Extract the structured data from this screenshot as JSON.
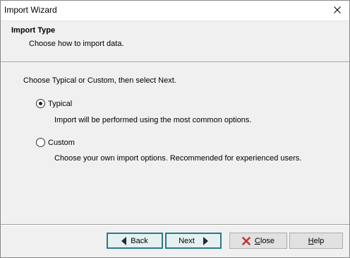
{
  "window": {
    "title": "Import Wizard"
  },
  "header": {
    "title": "Import Type",
    "subtitle": "Choose how to import data."
  },
  "body": {
    "instruction": "Choose Typical or Custom, then select Next.",
    "options": [
      {
        "label": "Typical",
        "description": "Import will be performed using the most common options.",
        "selected": true
      },
      {
        "label": "Custom",
        "description": "Choose your own import options. Recommended for experienced users.",
        "selected": false
      }
    ]
  },
  "footer": {
    "back_label": "Back",
    "next_label": "Next",
    "close_label_underlined": "C",
    "close_label_rest": "lose",
    "help_label_underlined": "H",
    "help_label_rest": "elp"
  },
  "colors": {
    "accent_border": "#2b7a8a",
    "close_icon": "#c0392b",
    "nav_arrow": "#1f2b3a",
    "panel_bg": "#f0f0f0"
  },
  "icons": {
    "window_close": "close-icon",
    "back": "arrow-left-icon",
    "next": "arrow-right-icon",
    "close": "red-x-icon"
  }
}
